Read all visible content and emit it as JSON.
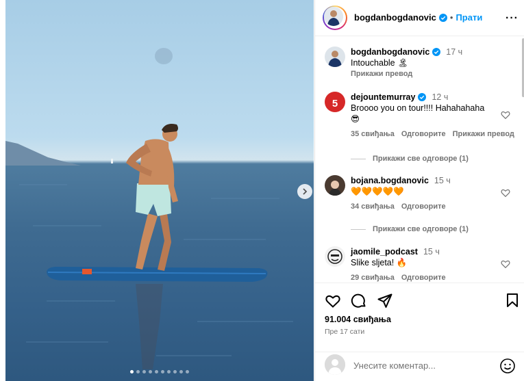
{
  "post": {
    "author": "bogdanbogdanovic",
    "follow_label": "Прати",
    "dot": "•",
    "more_label": "···",
    "photo": {
      "slide_count": 10,
      "active_slide": 1,
      "next_icon": "chevron-right-icon"
    }
  },
  "comments": [
    {
      "user": "bogdanbogdanovic",
      "verified": true,
      "time": "17 ч",
      "text": "Intouchable 🏝",
      "translate": "Прикажи превод",
      "avatar_color": "#d9e2ea"
    },
    {
      "user": "dejountemurray",
      "verified": true,
      "time": "12 ч",
      "text": "Broooo you on tour!!!! Hahahahaha",
      "emoji": "😎",
      "likes": "35 свиђања",
      "reply": "Одговорите",
      "translate": "Прикажи превод",
      "view_replies": "Прикажи све одговоре (1)",
      "avatar_color": "#d62828"
    },
    {
      "user": "bojana.bogdanovic",
      "verified": false,
      "time": "15 ч",
      "text": "🧡🧡🧡🧡🧡",
      "likes": "34 свиђања",
      "reply": "Одговорите",
      "view_replies": "Прикажи све одговоре (1)",
      "avatar_color": "#3a2a22"
    },
    {
      "user": "jaomile_podcast",
      "verified": false,
      "time": "15 ч",
      "text": "Slike sljeta! 🔥",
      "likes": "29 свиђања",
      "reply": "Одговорите",
      "avatar_color": "#f2f2f2"
    }
  ],
  "actions": {
    "icons": [
      "heart-icon",
      "comment-icon",
      "share-icon",
      "bookmark-icon"
    ],
    "likes": "91.004 свиђања",
    "posted": "Пре 17 сати"
  },
  "composer": {
    "placeholder": "Унесите коментар...",
    "emoji_icon": "smiley-icon"
  },
  "colors": {
    "link": "#0095f6",
    "muted": "#737373",
    "verified": "#0095f6"
  }
}
